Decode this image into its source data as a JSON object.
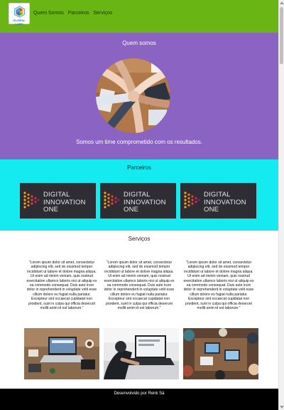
{
  "brand": {
    "logo_text": "GLOBAL LABS"
  },
  "nav": {
    "items": [
      "Quem Somos",
      "Parceiros",
      "Serviços"
    ]
  },
  "quem": {
    "title": "Quem somos",
    "tagline": "Somos um time comprometido com os resultados."
  },
  "parceiros": {
    "title": "Parceiros",
    "partners": [
      {
        "line1": "DIGITAL",
        "line2": "INNOVATION",
        "line3": "ONE"
      },
      {
        "line1": "DIGITAL",
        "line2": "INNOVATION",
        "line3": "ONE"
      },
      {
        "line1": "DIGITAL",
        "line2": "INNOVATION",
        "line3": "ONE"
      }
    ]
  },
  "servicos": {
    "title": "Serviços",
    "items": [
      {
        "text": "\"Lorem ipsum dolor sit amet, consectetur adipiscing elit, sed do eiusmod tempor incididunt ut labore et dolore magna aliqua. Ut enim ad minim veniam, quis nostrud exercitation ullamco laboris nisi ut aliquip ex ea commodo consequat. Duis aute irure dolor in reprehenderit in voluptate velit esse cillum dolore eu fugiat nulla pariatur. Excepteur sint occaecat cupidatat non proident, sunt in culpa qui officia deserunt mollit anim id est laborum.\""
      },
      {
        "text": "\"Lorem ipsum dolor sit amet, consectetur adipiscing elit, sed do eiusmod tempor incididunt ut labore et dolore magna aliqua. Ut enim ad minim veniam, quis nostrud exercitation ullamco laboris nisi ut aliquip ex ea commodo consequat. Duis aute irure dolor in reprehenderit in voluptate velit esse cillum dolore eu fugiat nulla pariatur. Excepteur sint occaecat cupidatat non proident, sunt in culpa qui officia deserunt mollit anim id est laborum.\""
      },
      {
        "text": "\"Lorem ipsum dolor sit amet, consectetur adipiscing elit, sed do eiusmod tempor incididunt ut labore et dolore magna aliqua. Ut enim ad minim veniam, quis nostrud exercitation ullamco laboris nisi ut aliquip ex ea commodo consequat. Duis aute irure dolor in reprehenderit in voluptate velit esse cillum dolore eu fugiat nulla pariatur. Excepteur sint occaecat cupidatat non proident, sunt in culpa qui officia deserunt mollit anim id est laborum.\""
      }
    ]
  },
  "footer": {
    "text": "Desenvolvido por Renk Sá"
  },
  "colors": {
    "navbar": "#68b514",
    "quem_bg": "#8a63c3",
    "parceiros_bg": "#13ebf0",
    "footer_bg": "#000000"
  }
}
